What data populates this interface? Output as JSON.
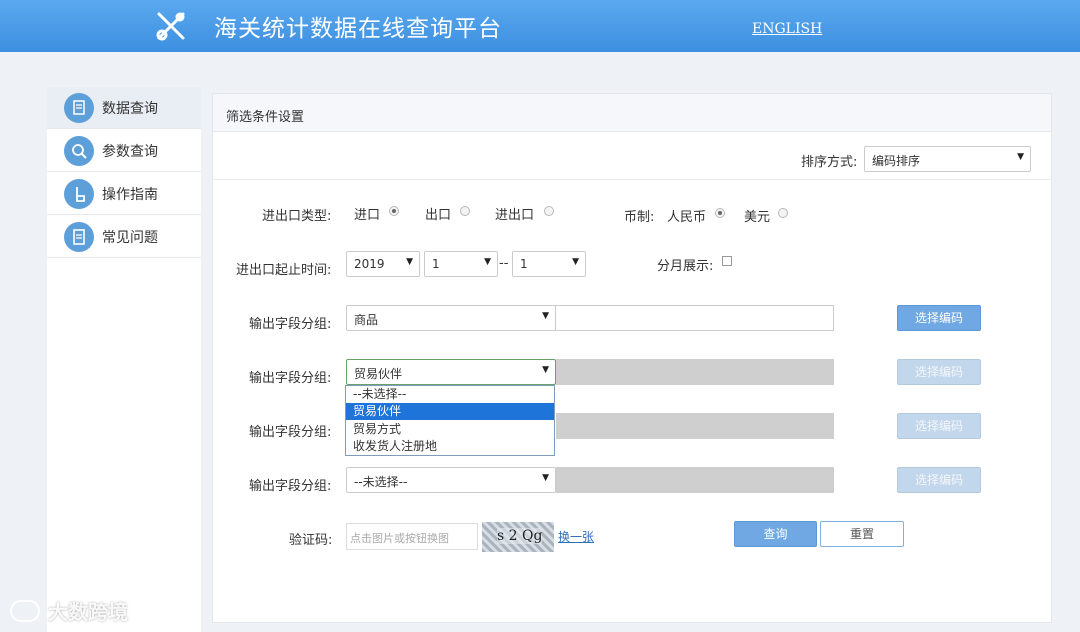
{
  "header": {
    "title": "海关统计数据在线查询平台",
    "lang_link": "ENGLISH"
  },
  "sidebar": {
    "items": [
      {
        "label": "数据查询",
        "icon": "document-search-icon",
        "active": true
      },
      {
        "label": "参数查询",
        "icon": "magnifier-icon",
        "active": false
      },
      {
        "label": "操作指南",
        "icon": "hand-pointer-icon",
        "active": false
      },
      {
        "label": "常见问题",
        "icon": "clipboard-icon",
        "active": false
      }
    ]
  },
  "panel": {
    "title": "筛选条件设置",
    "sort": {
      "label": "排序方式:",
      "value": "编码排序"
    },
    "trade_type": {
      "label": "进出口类型:",
      "options": [
        {
          "label": "进口",
          "checked": true
        },
        {
          "label": "出口",
          "checked": false
        },
        {
          "label": "进出口",
          "checked": false
        }
      ]
    },
    "currency": {
      "label": "币制:",
      "options": [
        {
          "label": "人民币",
          "checked": true
        },
        {
          "label": "美元",
          "checked": false
        }
      ]
    },
    "period": {
      "label": "进出口起止时间:",
      "year": "2019",
      "start_month": "1",
      "separator": "--",
      "end_month": "1"
    },
    "monthly": {
      "label": "分月展示:",
      "checked": false
    },
    "output_groups": [
      {
        "label": "输出字段分组:",
        "value": "商品",
        "enabled": true
      },
      {
        "label": "输出字段分组:",
        "value": "贸易伙伴",
        "enabled": false
      },
      {
        "label": "输出字段分组:",
        "value": "",
        "enabled": false
      },
      {
        "label": "输出字段分组:",
        "value": "--未选择--",
        "enabled": false
      }
    ],
    "select_code_label": "选择编码",
    "dropdown_options": [
      "--未选择--",
      "贸易伙伴",
      "贸易方式",
      "收发货人注册地"
    ],
    "dropdown_selected_index": 1,
    "captcha": {
      "label": "验证码:",
      "placeholder": "点击图片或按钮换图",
      "image_text": "s 2 Qg",
      "refresh_link": "换一张"
    },
    "query_button": "查询",
    "reset_button": "重置"
  },
  "watermark": {
    "text": "大数跨境"
  },
  "colors": {
    "header_blue": "#3d8fe0",
    "button_blue": "#6fa8e3",
    "selected_option": "#1e74d8"
  }
}
